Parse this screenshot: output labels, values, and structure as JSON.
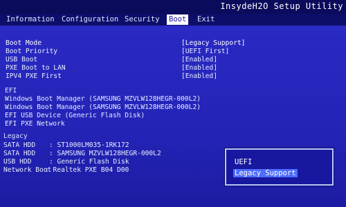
{
  "header": {
    "vendor_title": "InsydeH2O Setup Utility"
  },
  "menu": {
    "tabs": [
      {
        "label": "Information"
      },
      {
        "label": "Configuration"
      },
      {
        "label": "Security"
      },
      {
        "label": "Boot"
      },
      {
        "label": "Exit"
      }
    ],
    "active_tab": "Boot"
  },
  "settings": [
    {
      "label": "Boot Mode",
      "value": "[Legacy Support]"
    },
    {
      "label": "Boot Priority",
      "value": "[UEFI First]"
    },
    {
      "label": "USB Boot",
      "value": "[Enabled]"
    },
    {
      "label": "PXE Boot to LAN",
      "value": "[Enabled]"
    },
    {
      "label": "IPV4 PXE First",
      "value": "[Enabled]"
    }
  ],
  "efi": {
    "heading": "EFI",
    "items": [
      "Windows Boot Manager (SAMSUNG MZVLW128HEGR-000L2)",
      "Windows Boot Manager (SAMSUNG MZVLW128HEGR-000L2)",
      "EFI USB Device (Generic Flash Disk)",
      "EFI PXE Network"
    ]
  },
  "legacy": {
    "heading": "Legacy",
    "items": [
      {
        "label": "SATA HDD",
        "value": ": ST1000LM035-1RK172"
      },
      {
        "label": "SATA HDD",
        "value": ": SAMSUNG MZVLW128HEGR-000L2"
      },
      {
        "label": "USB HDD",
        "value": ": Generic Flash Disk"
      },
      {
        "label": "Network Boot",
        "value": ": Realtek PXE B04 D00"
      }
    ]
  },
  "popup": {
    "options": [
      "UEFI",
      "Legacy Support"
    ],
    "selected": "Legacy Support"
  },
  "colors": {
    "background": "#2323b6",
    "title_bar": "#0b0b5c",
    "active_tab_bg": "#ffffff",
    "highlight": "#4e6dff"
  }
}
